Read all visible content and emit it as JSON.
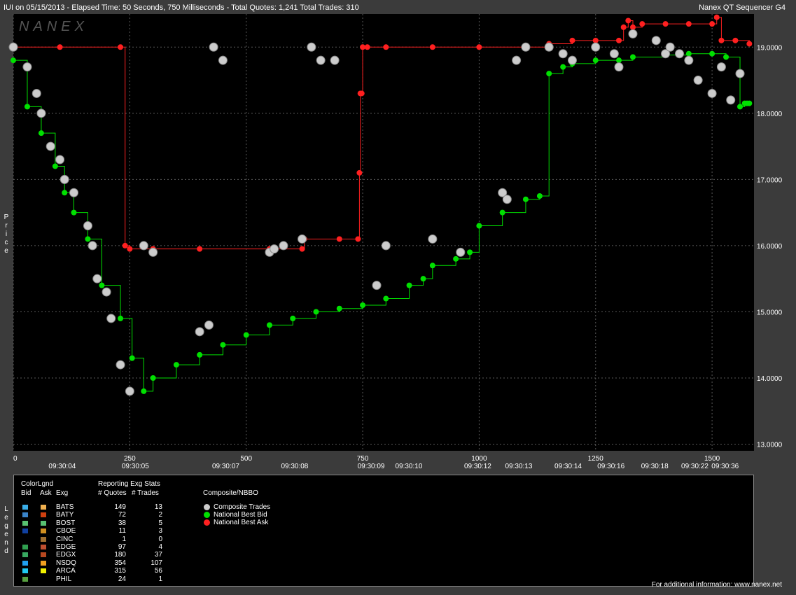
{
  "header": {
    "left": "IUI on 05/15/2013  -  Elapsed Time: 50 Seconds, 750 Milliseconds  -  Total Quotes: 1,241  Total Trades: 310",
    "right": "Nanex QT Sequencer G4",
    "watermark": "NANEX"
  },
  "chart_data": {
    "type": "line",
    "ylabel": "Price",
    "ylim": [
      12.9,
      19.5
    ],
    "xlim": [
      0,
      1590
    ],
    "y_ticks": [
      "13.0000",
      "14.0000",
      "15.0000",
      "16.0000",
      "17.0000",
      "18.0000",
      "19.0000"
    ],
    "y_tick_values": [
      13,
      14,
      15,
      16,
      17,
      18,
      19
    ],
    "x_ticks": [
      "0",
      "250",
      "500",
      "750",
      "1000",
      "1250",
      "1500"
    ],
    "x_tick_values": [
      0,
      250,
      500,
      750,
      1000,
      1250,
      1500
    ],
    "time_labels": [
      "09:30:04",
      "09:30:05",
      "09:30:07",
      "09:30:08",
      "09:30:09",
      "09:30:10",
      "09:30:12",
      "09:30:13",
      "09:30:14",
      "09:30:16",
      "09:30:18",
      "09:30:22",
      "09:30:36"
    ],
    "time_label_x": [
      105,
      262,
      456,
      604,
      768,
      849,
      997,
      1085,
      1191,
      1283,
      1377,
      1463,
      1528
    ],
    "series": [
      {
        "name": "National Best Bid",
        "color": "#00e000",
        "x": [
          0,
          30,
          60,
          90,
          110,
          130,
          160,
          190,
          230,
          255,
          280,
          300,
          350,
          400,
          450,
          500,
          550,
          600,
          650,
          700,
          750,
          800,
          850,
          880,
          900,
          950,
          980,
          1000,
          1050,
          1100,
          1130,
          1150,
          1180,
          1200,
          1250,
          1300,
          1330,
          1400,
          1450,
          1500,
          1530,
          1560,
          1570,
          1575,
          1580
        ],
        "y": [
          18.8,
          18.1,
          17.7,
          17.2,
          16.8,
          16.5,
          16.1,
          15.4,
          14.9,
          14.3,
          13.8,
          14.0,
          14.2,
          14.35,
          14.5,
          14.65,
          14.8,
          14.9,
          15.0,
          15.05,
          15.1,
          15.2,
          15.4,
          15.5,
          15.7,
          15.8,
          15.9,
          16.3,
          16.5,
          16.7,
          16.75,
          18.6,
          18.7,
          18.75,
          18.8,
          18.8,
          18.85,
          18.88,
          18.9,
          18.9,
          18.85,
          18.1,
          18.15,
          18.15,
          18.15
        ]
      },
      {
        "name": "National Best Ask",
        "color": "#ff2020",
        "x": [
          0,
          100,
          230,
          240,
          250,
          300,
          400,
          550,
          620,
          625,
          700,
          740,
          743,
          745,
          748,
          750,
          760,
          800,
          900,
          1000,
          1100,
          1150,
          1200,
          1250,
          1300,
          1310,
          1320,
          1330,
          1350,
          1400,
          1450,
          1500,
          1510,
          1520,
          1550,
          1580
        ],
        "y": [
          19.0,
          19.0,
          19.0,
          16.0,
          15.95,
          15.95,
          15.95,
          15.95,
          15.95,
          16.1,
          16.1,
          16.1,
          17.1,
          18.3,
          18.3,
          19.0,
          19.0,
          19.0,
          19.0,
          19.0,
          19.0,
          19.05,
          19.1,
          19.1,
          19.1,
          19.3,
          19.4,
          19.3,
          19.35,
          19.35,
          19.35,
          19.35,
          19.45,
          19.1,
          19.1,
          19.05
        ]
      }
    ],
    "composite_trades": {
      "name": "Composite Trades",
      "color": "#cccccc",
      "x": [
        0,
        30,
        50,
        60,
        80,
        100,
        110,
        130,
        160,
        170,
        180,
        200,
        210,
        230,
        250,
        280,
        300,
        400,
        420,
        430,
        450,
        550,
        560,
        580,
        620,
        640,
        660,
        690,
        780,
        800,
        900,
        960,
        1050,
        1060,
        1080,
        1100,
        1150,
        1180,
        1200,
        1250,
        1290,
        1300,
        1330,
        1380,
        1400,
        1410,
        1430,
        1450,
        1470,
        1500,
        1520,
        1540,
        1560
      ],
      "y": [
        19.0,
        18.7,
        18.3,
        18.0,
        17.5,
        17.3,
        17.0,
        16.8,
        16.3,
        16.0,
        15.5,
        15.3,
        14.9,
        14.2,
        13.8,
        16.0,
        15.9,
        14.7,
        14.8,
        19.0,
        18.8,
        15.9,
        15.95,
        16.0,
        16.1,
        19.0,
        18.8,
        18.8,
        15.4,
        16.0,
        16.1,
        15.9,
        16.8,
        16.7,
        18.8,
        19.0,
        19.0,
        18.9,
        18.8,
        19.0,
        18.9,
        18.7,
        19.2,
        19.1,
        18.9,
        19.0,
        18.9,
        18.8,
        18.5,
        18.3,
        18.7,
        18.2,
        18.6
      ]
    }
  },
  "legend": {
    "title_color": "ColorLgnd",
    "col_bid": "Bid",
    "col_ask": "Ask",
    "col_exg": "Exg",
    "title_stats": "Reporting Exg Stats",
    "col_quotes": "# Quotes",
    "col_trades": "# Trades",
    "title_composite": "Composite/NBBO",
    "side_label": "Legend",
    "exchanges": [
      {
        "exg": "BATS",
        "quotes": "149",
        "trades": "13",
        "bid": "#3aaee8",
        "ask": "#f0b050"
      },
      {
        "exg": "BATY",
        "quotes": "72",
        "trades": "2",
        "bid": "#3a84c8",
        "ask": "#d04010"
      },
      {
        "exg": "BOST",
        "quotes": "38",
        "trades": "5",
        "bid": "#58c070",
        "ask": "#58c070"
      },
      {
        "exg": "CBOE",
        "quotes": "11",
        "trades": "3",
        "bid": "#1040a0",
        "ask": "#d09020"
      },
      {
        "exg": "CINC",
        "quotes": "1",
        "trades": "0",
        "bid": "#000000",
        "ask": "#a07030"
      },
      {
        "exg": "EDGE",
        "quotes": "97",
        "trades": "4",
        "bid": "#30a050",
        "ask": "#c05030"
      },
      {
        "exg": "EDGX",
        "quotes": "180",
        "trades": "37",
        "bid": "#38a860",
        "ask": "#b84820"
      },
      {
        "exg": "NSDQ",
        "quotes": "354",
        "trades": "107",
        "bid": "#20a0f0",
        "ask": "#f0a020"
      },
      {
        "exg": "ARCA",
        "quotes": "315",
        "trades": "56",
        "bid": "#20c8f0",
        "ask": "#f0f000"
      },
      {
        "exg": "PHIL",
        "quotes": "24",
        "trades": "1",
        "bid": "#58a040",
        "ask": "#000000"
      }
    ],
    "composite": [
      {
        "label": "Composite Trades",
        "color": "#cccccc"
      },
      {
        "label": "National Best Bid",
        "color": "#00e000"
      },
      {
        "label": "National Best Ask",
        "color": "#ff2020"
      }
    ]
  },
  "footer": "For additional information: www.nanex.net"
}
